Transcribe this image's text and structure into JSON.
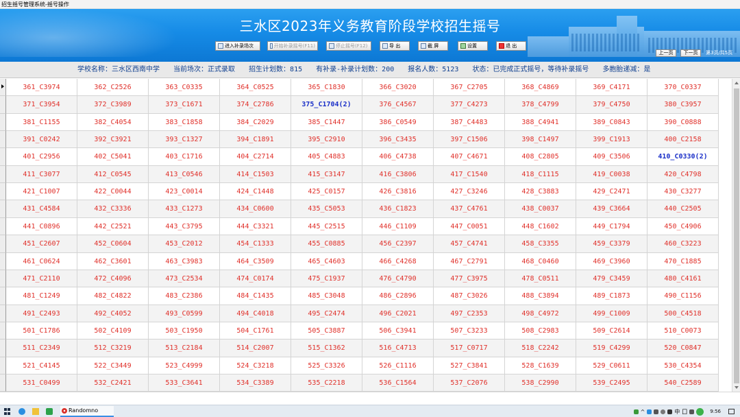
{
  "window": {
    "title": "招生摇号管理系统-摇号操作"
  },
  "banner": {
    "title": "三水区2023年义务教育阶段学校招生摇号"
  },
  "toolbar": {
    "enter_makeup": "进入补录场次",
    "start_makeup": "开始补录摇号(F11)",
    "stop_draw": "停止摇号(F12)",
    "export": "导 出",
    "screenshot": "截 屏",
    "settings": "设置",
    "exit": "退 出"
  },
  "pager": {
    "prev": "上一页",
    "next": "下一页",
    "info": "第3页/共5页"
  },
  "info": {
    "school": "学校名称：三水区西南中学",
    "session": "当前场次：正式录取",
    "plan": "招生计划数：815",
    "makeup_plan": "有补录-补录计划数：200",
    "applicants": "报名人数：5123",
    "status": "状态：已完成正式摇号，等待补录摇号",
    "multi": "多胞胎递减：是"
  },
  "grid": {
    "rows": [
      [
        "361_C3974",
        "362_C2526",
        "363_C0335",
        "364_C0525",
        "365_C1830",
        "366_C3020",
        "367_C2705",
        "368_C4869",
        "369_C4171",
        "370_C0337"
      ],
      [
        "371_C3954",
        "372_C3989",
        "373_C1671",
        "374_C2786",
        "375_C1704(2)",
        "376_C4567",
        "377_C4273",
        "378_C4799",
        "379_C4750",
        "380_C3957"
      ],
      [
        "381_C1155",
        "382_C4054",
        "383_C1858",
        "384_C2029",
        "385_C1447",
        "386_C0549",
        "387_C4483",
        "388_C4941",
        "389_C0843",
        "390_C0888"
      ],
      [
        "391_C0242",
        "392_C3921",
        "393_C1327",
        "394_C1891",
        "395_C2910",
        "396_C3435",
        "397_C1506",
        "398_C1497",
        "399_C1913",
        "400_C2158"
      ],
      [
        "401_C2956",
        "402_C5041",
        "403_C1716",
        "404_C2714",
        "405_C4883",
        "406_C4738",
        "407_C4671",
        "408_C2805",
        "409_C3506",
        "410_C0330(2)"
      ],
      [
        "411_C3077",
        "412_C0545",
        "413_C0546",
        "414_C1503",
        "415_C3147",
        "416_C3806",
        "417_C1540",
        "418_C1115",
        "419_C0038",
        "420_C4798"
      ],
      [
        "421_C1007",
        "422_C0044",
        "423_C0014",
        "424_C1448",
        "425_C0157",
        "426_C3816",
        "427_C3246",
        "428_C3883",
        "429_C2471",
        "430_C3277"
      ],
      [
        "431_C4584",
        "432_C3336",
        "433_C1273",
        "434_C0600",
        "435_C5053",
        "436_C1823",
        "437_C4761",
        "438_C0037",
        "439_C3664",
        "440_C2505"
      ],
      [
        "441_C0896",
        "442_C2521",
        "443_C3795",
        "444_C3321",
        "445_C2515",
        "446_C1109",
        "447_C0051",
        "448_C1602",
        "449_C1794",
        "450_C4906"
      ],
      [
        "451_C2607",
        "452_C0604",
        "453_C2012",
        "454_C1333",
        "455_C0885",
        "456_C2397",
        "457_C4741",
        "458_C3355",
        "459_C3379",
        "460_C3223"
      ],
      [
        "461_C0624",
        "462_C3601",
        "463_C3983",
        "464_C3509",
        "465_C4603",
        "466_C4268",
        "467_C2791",
        "468_C0460",
        "469_C3960",
        "470_C1885"
      ],
      [
        "471_C2110",
        "472_C4096",
        "473_C2534",
        "474_C0174",
        "475_C1937",
        "476_C4790",
        "477_C3975",
        "478_C0511",
        "479_C3459",
        "480_C4161"
      ],
      [
        "481_C1249",
        "482_C4822",
        "483_C2386",
        "484_C1435",
        "485_C3048",
        "486_C2896",
        "487_C3026",
        "488_C3894",
        "489_C1873",
        "490_C1156"
      ],
      [
        "491_C2493",
        "492_C4052",
        "493_C0599",
        "494_C4018",
        "495_C2474",
        "496_C2021",
        "497_C2353",
        "498_C4972",
        "499_C1009",
        "500_C4518"
      ],
      [
        "501_C1786",
        "502_C4109",
        "503_C1950",
        "504_C1761",
        "505_C3887",
        "506_C3941",
        "507_C3233",
        "508_C2983",
        "509_C2614",
        "510_C0073"
      ],
      [
        "511_C2349",
        "512_C3219",
        "513_C2184",
        "514_C2007",
        "515_C1362",
        "516_C4713",
        "517_C0717",
        "518_C2242",
        "519_C4299",
        "520_C0847"
      ],
      [
        "521_C4145",
        "522_C3449",
        "523_C4999",
        "524_C3218",
        "525_C3326",
        "526_C1116",
        "527_C3841",
        "528_C1639",
        "529_C0611",
        "530_C4354"
      ],
      [
        "531_C0499",
        "532_C2421",
        "533_C3641",
        "534_C3389",
        "535_C2218",
        "536_C1564",
        "537_C2076",
        "538_C2990",
        "539_C2495",
        "540_C2589"
      ]
    ],
    "highlighted": [
      "375_C1704(2)",
      "410_C0330(2)"
    ],
    "colors": {
      "entry": "#e0302a",
      "highlight": "#1a2fc8"
    }
  },
  "taskbar": {
    "app_label": "Randomno",
    "time": "9:56",
    "ime": "中",
    "tray_text": "囗"
  }
}
